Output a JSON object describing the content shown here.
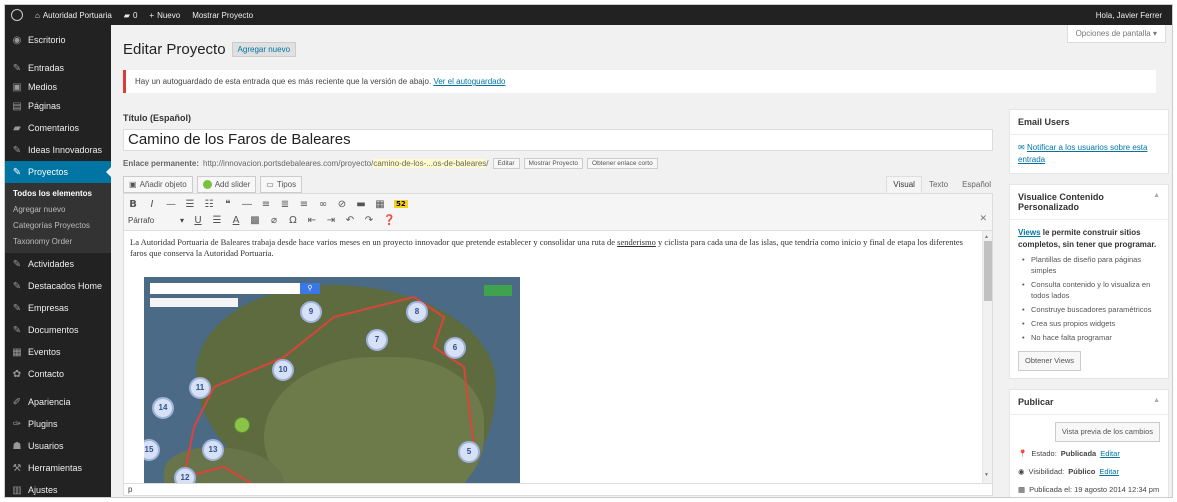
{
  "adminbar": {
    "site_name": "Autoridad Portuaria",
    "comments_count": "0",
    "new_label": "Nuevo",
    "view_label": "Mostrar Proyecto",
    "greeting": "Hola, Javier Ferrer"
  },
  "sidebar": {
    "items": [
      {
        "label": "Escritorio",
        "icon": "dashboard-icon"
      },
      {
        "label": "Entradas",
        "icon": "pin-icon"
      },
      {
        "label": "Medios",
        "icon": "media-icon"
      },
      {
        "label": "Páginas",
        "icon": "page-icon"
      },
      {
        "label": "Comentarios",
        "icon": "comment-icon"
      },
      {
        "label": "Ideas Innovadoras",
        "icon": "pin-icon"
      },
      {
        "label": "Proyectos",
        "icon": "pin-icon"
      }
    ],
    "submenu": [
      "Todos los elementos",
      "Agregar nuevo",
      "Categorías Proyectos",
      "Taxonomy Order"
    ],
    "items2": [
      {
        "label": "Actividades",
        "icon": "pin-icon"
      },
      {
        "label": "Destacados Home",
        "icon": "pin-icon"
      },
      {
        "label": "Empresas",
        "icon": "pin-icon"
      },
      {
        "label": "Documentos",
        "icon": "pin-icon"
      },
      {
        "label": "Eventos",
        "icon": "calendar-icon"
      },
      {
        "label": "Contacto",
        "icon": "gear-icon"
      }
    ],
    "items3": [
      {
        "label": "Apariencia",
        "icon": "brush-icon"
      },
      {
        "label": "Plugins",
        "icon": "plugin-icon"
      },
      {
        "label": "Usuarios",
        "icon": "user-icon"
      },
      {
        "label": "Herramientas",
        "icon": "wrench-icon"
      },
      {
        "label": "Ajustes",
        "icon": "settings-icon"
      }
    ]
  },
  "header": {
    "screen_options": "Opciones de pantalla",
    "title": "Editar Proyecto",
    "add_new": "Agregar nuevo"
  },
  "notice": {
    "text": "Hay un autoguardado de esta entrada que es más reciente que la versión de abajo.",
    "link": "Ver el autoguardado"
  },
  "editor": {
    "title_label": "Título (Español)",
    "title_value": "Camino de los Faros de Baleares",
    "permalink_label": "Enlace permanente:",
    "permalink_base": "http://innovacion.portsdebaleares.com/proyecto/",
    "permalink_slug": "camino-de-los-...os-de-baleares",
    "permalink_end": "/",
    "btn_edit": "Editar",
    "btn_view": "Mostrar Proyecto",
    "btn_shortlink": "Obtener enlace corto",
    "add_object": "Añadir objeto",
    "add_slider": "Add slider",
    "types": "Tipos",
    "tab_visual": "Visual",
    "tab_text": "Texto",
    "tab_lang": "Español",
    "format": "Párrafo",
    "content_before": "La Autoridad Portuaria de Baleares trabaja desde hace varios meses en un proyecto innovador que pretende establecer y consolidar una ruta de ",
    "content_link": "senderismo",
    "content_after": " y ciclista para cada una de las islas, que tendría como inicio y final de etapa los diferentes faros que conserva la Autoridad Portuaria.",
    "status_path": "p",
    "map_markers": [
      "9",
      "8",
      "7",
      "6",
      "10",
      "11",
      "14",
      "15",
      "13",
      "12",
      "5"
    ]
  },
  "right": {
    "email_users": {
      "title": "Email Users",
      "link": "Notificar a los usuarios sobre esta entrada"
    },
    "views": {
      "title": "Visualice Contenido Personalizado",
      "intro_link": "Views",
      "intro_text": " le permite construir sitios completos, sin tener que programar.",
      "bullets": [
        "Plantillas de diseño para páginas simples",
        "Consulta contenido y lo visualiza en todos lados",
        "Construye buscadores paramétricos",
        "Crea sus propios widgets",
        "No hace falta programar"
      ],
      "button": "Obtener Views"
    },
    "publish": {
      "title": "Publicar",
      "preview_button": "Vista previa de los cambios",
      "status_label": "Estado: ",
      "status_value": "Publicada",
      "status_edit": "Editar",
      "visibility_label": "Visibilidad: ",
      "visibility_value": "Público",
      "visibility_edit": "Editar",
      "published_on": "Publicada el: 19 agosto 2014 12:34 pm"
    }
  }
}
